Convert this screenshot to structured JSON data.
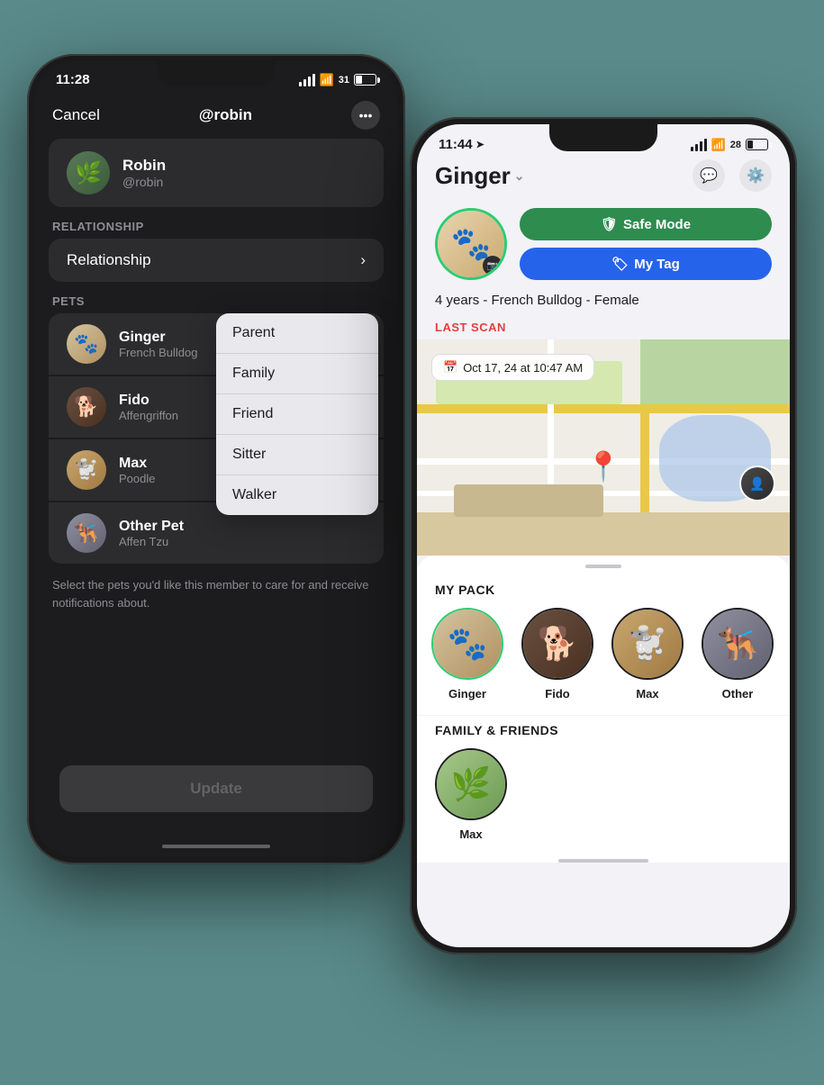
{
  "phone1": {
    "status": {
      "time": "11:28",
      "battery": "31"
    },
    "header": {
      "cancel": "Cancel",
      "title": "@robin",
      "more": "..."
    },
    "user": {
      "name": "Robin",
      "handle": "@robin"
    },
    "relationship": {
      "label": "Relationship",
      "dropdown": {
        "items": [
          "Parent",
          "Family",
          "Friend",
          "Sitter",
          "Walker"
        ]
      }
    },
    "pets_label": "PETS",
    "pets": [
      {
        "name": "Ginger",
        "breed": "French Bulldog"
      },
      {
        "name": "Fido",
        "breed": "Affengriffon"
      },
      {
        "name": "Max",
        "breed": "Poodle"
      },
      {
        "name": "Other Pet",
        "breed": "Affen Tzu"
      }
    ],
    "helper_text": "Select the pets you'd like this member to care for and receive notifications about.",
    "update_button": "Update"
  },
  "phone2": {
    "status": {
      "time": "11:44",
      "battery": "28"
    },
    "pet_name": "Ginger",
    "pet_details": "4 years - French Bulldog - Female",
    "safe_mode": "Safe Mode",
    "my_tag": "My Tag",
    "last_scan_label": "LAST SCAN",
    "scan_date": "Oct 17, 24 at 10:47 AM",
    "my_pack_label": "MY PACK",
    "pack_members": [
      {
        "name": "Ginger"
      },
      {
        "name": "Fido"
      },
      {
        "name": "Max"
      },
      {
        "name": "Other"
      }
    ],
    "family_friends_label": "FAMILY & FRIENDS",
    "family_members": [
      {
        "name": "Max"
      }
    ]
  }
}
